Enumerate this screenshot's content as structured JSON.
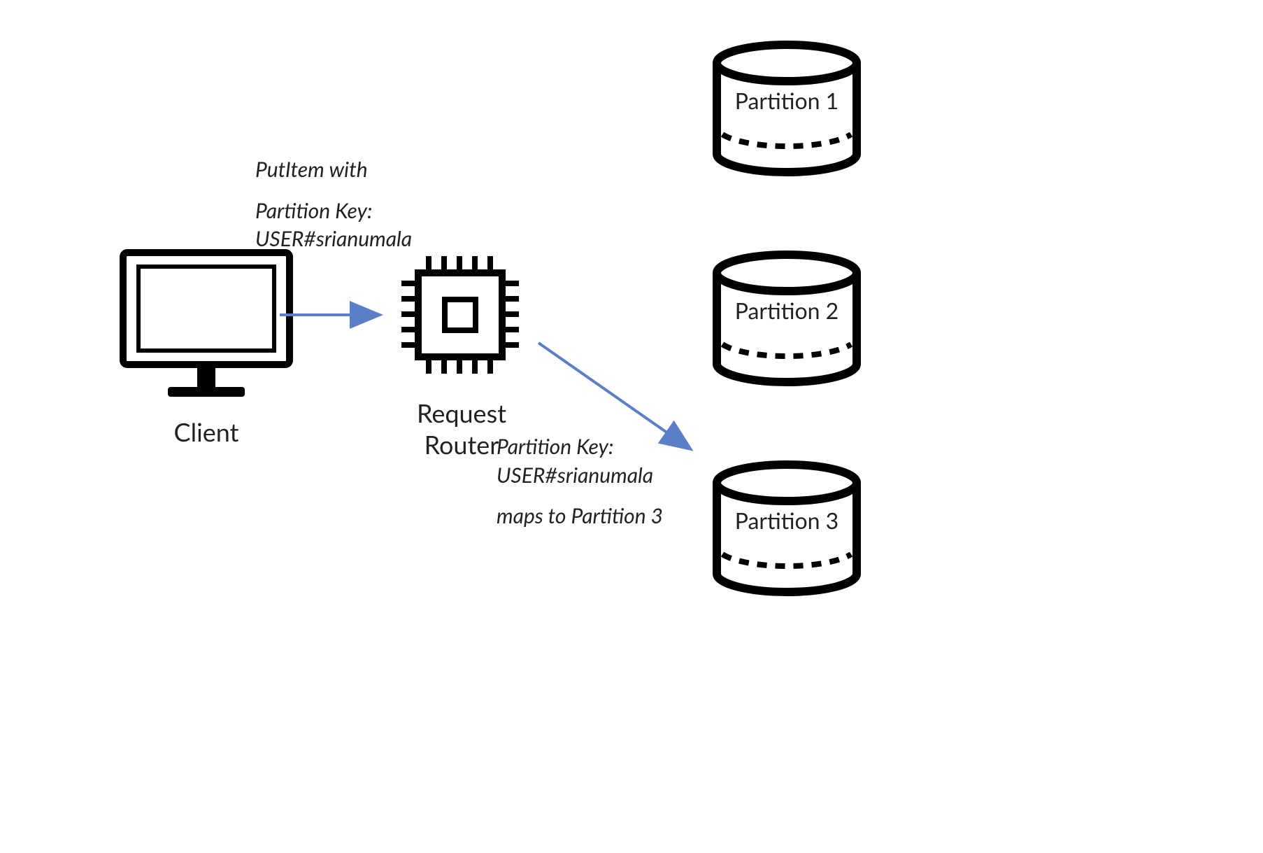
{
  "nodes": {
    "client": {
      "label": "Client"
    },
    "router": {
      "label_line1": "Request",
      "label_line2": "Router"
    }
  },
  "partitions": {
    "p1": {
      "label": "Partition 1"
    },
    "p2": {
      "label": "Partition 2"
    },
    "p3": {
      "label": "Partition 3"
    }
  },
  "annotations": {
    "request": {
      "line1": "PutItem with",
      "line2": "Partition Key:",
      "line3": "USER#srianumala"
    },
    "routing": {
      "line1": "Partition Key:",
      "line2": "USER#srianumala",
      "line3": "maps to Partition 3"
    }
  },
  "colors": {
    "arrow": "#5b7fc7",
    "stroke": "#000000"
  }
}
